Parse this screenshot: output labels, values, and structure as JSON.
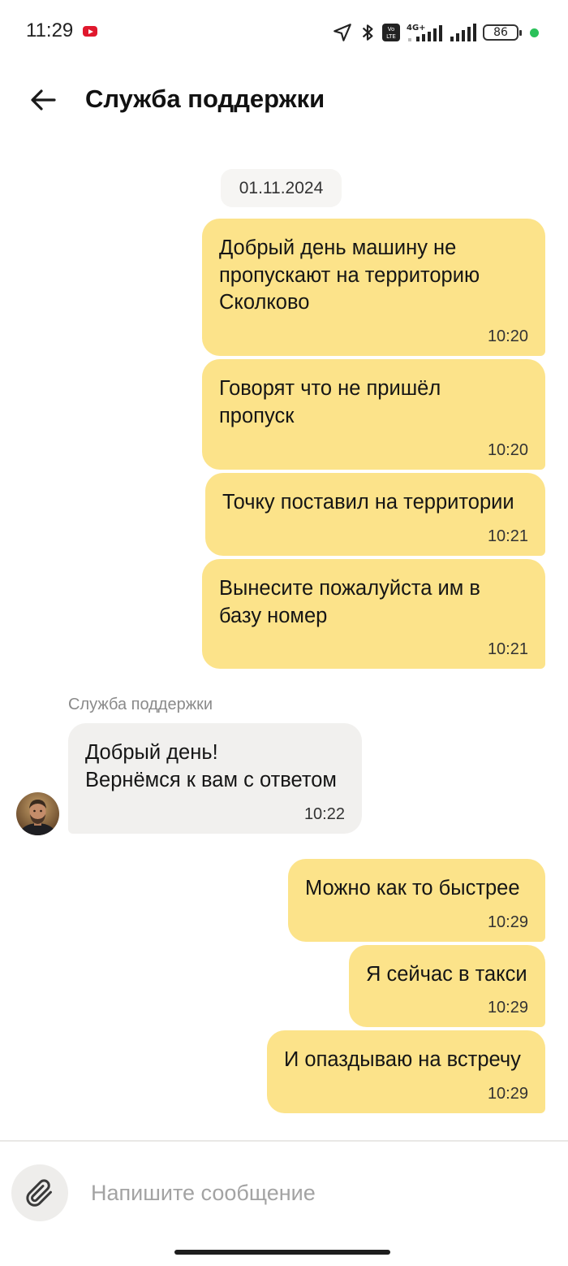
{
  "status_bar": {
    "time": "11:29",
    "battery": "86",
    "network": "4G+",
    "volte": "Vo LTE"
  },
  "header": {
    "title": "Служба поддержки"
  },
  "chat": {
    "date": "01.11.2024",
    "sender_name": "Служба поддержки",
    "messages": [
      {
        "direction": "out",
        "text": "Добрый день машину не\nпропускают на территорию\nСколково",
        "time": "10:20"
      },
      {
        "direction": "out",
        "text": "Говорят что не пришёл\nпропуск",
        "time": "10:20"
      },
      {
        "direction": "out",
        "text": "Точку поставил на территории",
        "time": "10:21"
      },
      {
        "direction": "out",
        "text": "Вынесите пожалуйста им в\nбазу номер",
        "time": "10:21"
      },
      {
        "direction": "in",
        "text": "Добрый день!\nВернёмся к вам с ответом",
        "time": "10:22"
      },
      {
        "direction": "out",
        "text": "Можно как то быстрее",
        "time": "10:29"
      },
      {
        "direction": "out",
        "text": "Я сейчас в такси",
        "time": "10:29"
      },
      {
        "direction": "out",
        "text": "И опаздываю на встречу",
        "time": "10:29"
      }
    ]
  },
  "composer": {
    "placeholder": "Напишите сообщение"
  },
  "colors": {
    "outgoing_bubble": "#fce38a",
    "incoming_bubble": "#f1f0ee",
    "youtube_red": "#e0182d",
    "status_dot": "#2bc15a"
  },
  "icons": {
    "back": "arrow-left-icon",
    "attach": "paperclip-icon",
    "location": "location-arrow-icon",
    "bluetooth": "bluetooth-icon",
    "signal": "signal-icon",
    "battery": "battery-icon"
  }
}
